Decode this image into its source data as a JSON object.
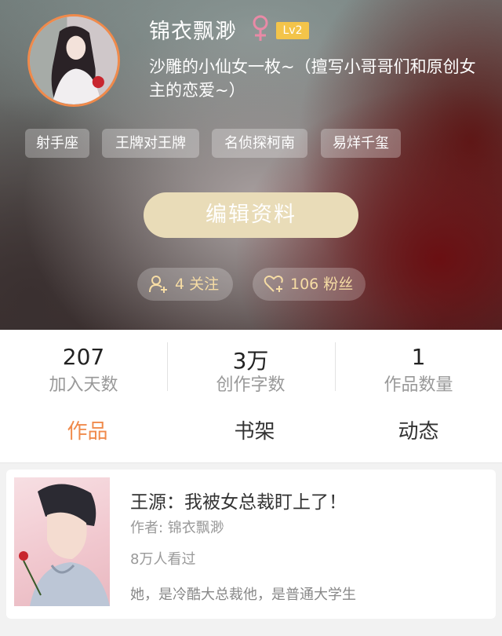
{
  "profile": {
    "nickname": "锦衣飘渺",
    "level": "Lv2",
    "bio": "沙雕的小仙女一枚~（擅写小哥哥们和原创女主的恋爱~）",
    "tags": [
      "射手座",
      "王牌对王牌",
      "名侦探柯南",
      "易烊千玺"
    ],
    "edit_button": "编辑资料",
    "following": "4 关注",
    "followers": "106 粉丝"
  },
  "stats": [
    {
      "value": "207",
      "label": "加入天数"
    },
    {
      "value": "3万",
      "label": "创作字数"
    },
    {
      "value": "1",
      "label": "作品数量"
    }
  ],
  "tabs": [
    "作品",
    "书架",
    "动态"
  ],
  "book": {
    "title": "王源：我被女总裁盯上了！",
    "author": "作者: 锦衣飘渺",
    "views": "8万人看过",
    "description": "她，是冷酷大总裁他，是普通大学生"
  },
  "colors": {
    "accent": "#f08a4b",
    "level_badge": "#f3c44a",
    "edit_button": "#e9dcb8",
    "follow_text": "#f6dca4",
    "gender": "#e98aa6"
  },
  "icons": {
    "gender": "female-icon",
    "following": "add-user-icon",
    "followers": "heart-plus-icon"
  }
}
